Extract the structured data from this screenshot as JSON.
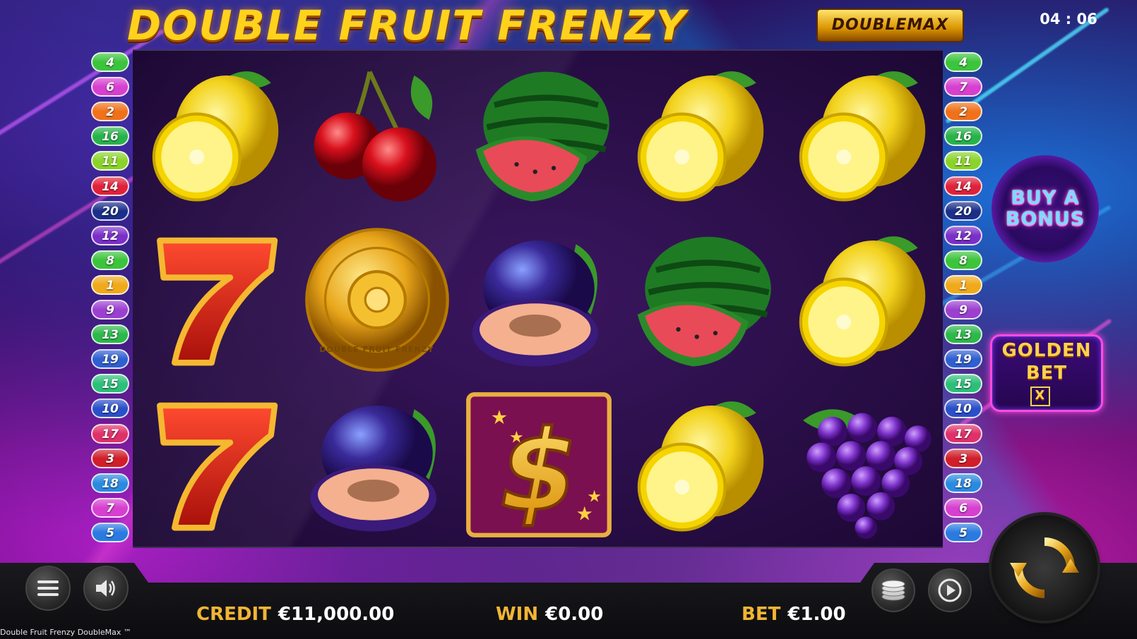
{
  "header": {
    "title": "DOUBLE FRUIT FRENZY",
    "badge": "DOUBLEMAX",
    "clock": "04 : 06"
  },
  "reels": {
    "rows": [
      [
        "lemon",
        "cherries",
        "watermelon",
        "lemon",
        "lemon"
      ],
      [
        "seven",
        "coin",
        "plum",
        "watermelon",
        "lemon"
      ],
      [
        "seven",
        "plum",
        "dollar",
        "lemon",
        "grapes"
      ]
    ],
    "coin_text": "DOUBLE FRUIT FRENZY"
  },
  "paylines": {
    "left": [
      "4",
      "6",
      "2",
      "16",
      "11",
      "14",
      "20",
      "12",
      "8",
      "1",
      "9",
      "13",
      "19",
      "15",
      "10",
      "17",
      "3",
      "18",
      "7",
      "5"
    ],
    "right": [
      "4",
      "7",
      "2",
      "16",
      "11",
      "14",
      "20",
      "12",
      "8",
      "1",
      "9",
      "13",
      "19",
      "15",
      "10",
      "17",
      "3",
      "18",
      "6",
      "5"
    ],
    "colors": {
      "4": "#3cc43c",
      "6": "#d63fd0",
      "7": "#d63fd0",
      "2": "#f0711a",
      "16": "#27b34a",
      "11": "#8ad42a",
      "14": "#e0213a",
      "20": "#1b2f8a",
      "12": "#7a2fc8",
      "8": "#3cc43c",
      "1": "#f0a91a",
      "9": "#9b3fd0",
      "13": "#2cb84a",
      "19": "#2f5fd0",
      "15": "#2dbf7a",
      "10": "#2a4fc8",
      "17": "#e0306a",
      "3": "#d01e2a",
      "18": "#2a8ae0",
      "5": "#2a7ae0"
    }
  },
  "side_buttons": {
    "buy_bonus_line1": "BUY A",
    "buy_bonus_line2": "BONUS",
    "golden_line1": "GOLDEN",
    "golden_line2": "BET",
    "golden_x": "X"
  },
  "bottom": {
    "credit_label": "CREDIT",
    "credit_value": "€11,000.00",
    "win_label": "WIN",
    "win_value": "€0.00",
    "bet_label": "BET",
    "bet_value": "€1.00",
    "game_name": "Double Fruit Frenzy DoubleMax ™"
  },
  "icons": [
    "menu-icon",
    "sound-icon",
    "coins-icon",
    "autoplay-icon",
    "spin-icon"
  ]
}
